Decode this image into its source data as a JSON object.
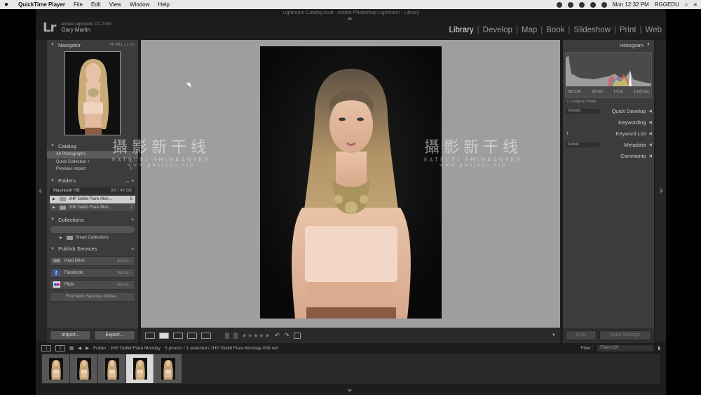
{
  "menubar": {
    "app": "QuickTime Player",
    "items": [
      "File",
      "Edit",
      "View",
      "Window",
      "Help"
    ],
    "clock": "Mon 12:32 PM",
    "user": "RGGEDU"
  },
  "window": {
    "title": "Lightroom Catalog.lrcat - Adobe Photoshop Lightroom - Library"
  },
  "identity": {
    "logo": "Lr",
    "product": "Adobe Lightroom CC 2015",
    "user": "Gary Martin"
  },
  "modules": [
    "Library",
    "Develop",
    "Map",
    "Book",
    "Slideshow",
    "Print",
    "Web"
  ],
  "modules_separator": "|",
  "left": {
    "navigator": {
      "title": "Navigator",
      "zoom": "FIT  FILL  1:1  3:1"
    },
    "catalog": {
      "title": "Catalog",
      "items": [
        {
          "label": "All Photographs",
          "count": ""
        },
        {
          "label": "Quick Collection +",
          "count": "0"
        },
        {
          "label": "Previous Import",
          "count": "0"
        }
      ]
    },
    "folders": {
      "title": "Folders",
      "drive": "Macintosh HD",
      "drive_size": "3/0 / 40 GB",
      "items": [
        {
          "label": "JHP Gellid Flare Mon...",
          "count": "5"
        },
        {
          "label": "JHP Gellid Flare Mon...",
          "count": "2"
        }
      ]
    },
    "collections": {
      "title": "Collections",
      "smart": "Smart Collections"
    },
    "publish": {
      "title": "Publish Services",
      "services": [
        {
          "label": "Hard Drive",
          "action": "Set Up..."
        },
        {
          "label": "Facebook",
          "action": "Set Up..."
        },
        {
          "label": "Flickr",
          "action": "Set Up..."
        }
      ],
      "find_more": "Find More Services Online..."
    },
    "import_label": "Import...",
    "export_label": "Export..."
  },
  "right": {
    "histogram": {
      "title": "Histogram",
      "iso": "ISO 100",
      "focal": "55 mm",
      "aperture": "f / 5.6",
      "shutter": "1/125 sec",
      "original": "Original Photo"
    },
    "panels": [
      {
        "title": "Quick Develop",
        "dropdown": "Defaults"
      },
      {
        "title": "Keywording",
        "dropdown": ""
      },
      {
        "title": "Keyword List",
        "dropdown": "+"
      },
      {
        "title": "Metadata",
        "dropdown": "Default"
      },
      {
        "title": "Comments",
        "dropdown": ""
      }
    ],
    "sync_label": "Sync",
    "sync_settings_label": "Sync Settings"
  },
  "filmstrip": {
    "pages": [
      "1",
      "2"
    ],
    "folder": "Folder : JHP Gellid Flare Monday",
    "info": "5 photos / 1 selected / JHP Gellid Flare Monday-009.nef",
    "filter_label": "Filter :",
    "filter_value": "Filters Off",
    "thumb_count": 5,
    "selected_index": 3
  },
  "watermark": {
    "cn": "攝影新干线",
    "en": "SATSUEI SHINKANSEN",
    "url": "www.photoss.vip"
  },
  "colors": {
    "accent": "#e8e8e8",
    "panel": "#3c3c3c",
    "background": "#9e9e9e"
  }
}
